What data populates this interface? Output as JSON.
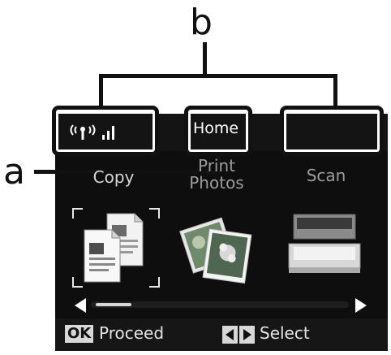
{
  "callouts": {
    "a": "a",
    "b": "b"
  },
  "status_bar": {
    "network_icon": "wifi-signal-icon",
    "mode_label": "Home",
    "status_area_text": ""
  },
  "menu": {
    "items": [
      {
        "label": "Copy",
        "icon": "copy-icon",
        "selected": true
      },
      {
        "label": "Print\nPhotos",
        "icon": "photos-icon",
        "selected": false
      },
      {
        "label": "Scan",
        "icon": "scanner-icon",
        "selected": false
      }
    ]
  },
  "footer": {
    "ok_badge": "OK",
    "proceed_label": "Proceed",
    "nav_icon": "left-right-arrows-icon",
    "select_label": "Select"
  },
  "colors": {
    "screen_bg": "#0e0e0e",
    "text_active": "#e4e4e4",
    "text_dim": "#9c9c9c",
    "highlight_border": "#111111"
  }
}
